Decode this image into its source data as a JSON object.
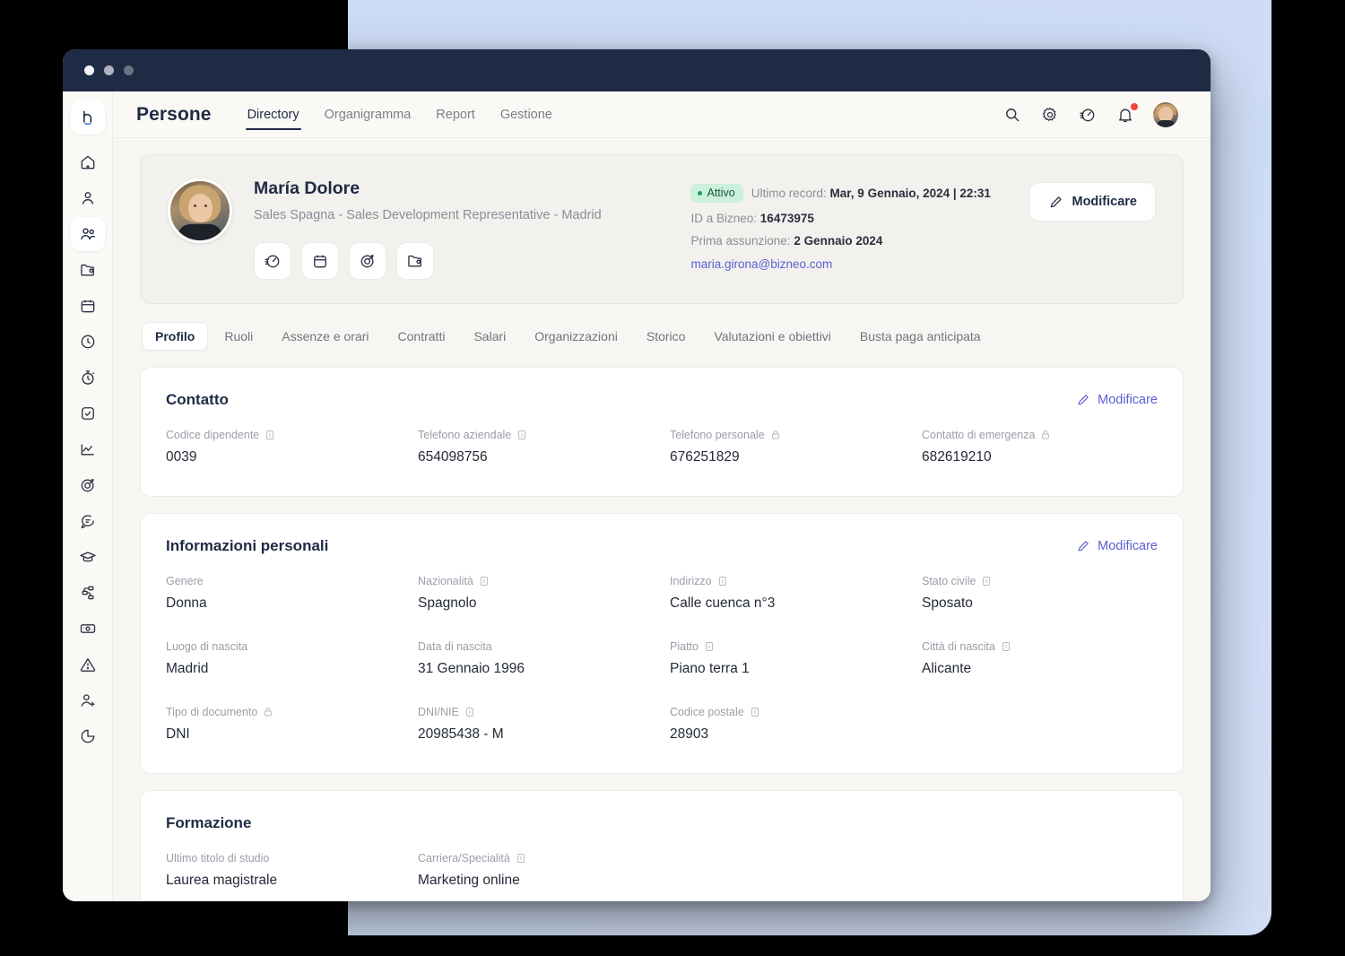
{
  "window": {
    "dots": [
      "close",
      "minimize",
      "maximize"
    ]
  },
  "header": {
    "app_title": "Persone",
    "nav": [
      {
        "label": "Directory",
        "active": true
      },
      {
        "label": "Organigramma",
        "active": false
      },
      {
        "label": "Report",
        "active": false
      },
      {
        "label": "Gestione",
        "active": false
      }
    ],
    "icons": [
      "search-icon",
      "gear-icon",
      "speedometer-icon",
      "bell-icon",
      "avatar"
    ]
  },
  "sidebar": {
    "logo": "bizneo-logo",
    "items": [
      {
        "icon": "home-icon",
        "active": false
      },
      {
        "icon": "user-icon",
        "active": false
      },
      {
        "icon": "people-icon",
        "active": true
      },
      {
        "icon": "folder-icon",
        "active": false
      },
      {
        "icon": "calendar-icon",
        "active": false
      },
      {
        "icon": "clock-icon",
        "active": false
      },
      {
        "icon": "stopwatch-icon",
        "active": false
      },
      {
        "icon": "check-square-icon",
        "active": false
      },
      {
        "icon": "chart-line-icon",
        "active": false
      },
      {
        "icon": "target-icon",
        "active": false
      },
      {
        "icon": "chat-icon",
        "active": false
      },
      {
        "icon": "graduation-cap-icon",
        "active": false
      },
      {
        "icon": "workflow-icon",
        "active": false
      },
      {
        "icon": "money-icon",
        "active": false
      },
      {
        "icon": "warning-icon",
        "active": false
      },
      {
        "icon": "user-plus-icon",
        "active": false
      },
      {
        "icon": "pie-chart-icon",
        "active": false
      }
    ]
  },
  "profile": {
    "name": "María Dolore",
    "role": "Sales Spagna - Sales Development Representative - Madrid",
    "quick_actions": [
      "speedometer-icon",
      "calendar-icon",
      "target-icon",
      "folder-icon"
    ],
    "status": "Attivo",
    "last_record_label": "Ultimo record:",
    "last_record_value": "Mar, 9 Gennaio, 2024 | 22:31",
    "bizneo_id_label": "ID a Bizneo:",
    "bizneo_id_value": "16473975",
    "first_hire_label": "Prima assunzione:",
    "first_hire_value": "2 Gennaio 2024",
    "email": "maria.girona@bizneo.com",
    "edit_label": "Modificare"
  },
  "section_tabs": [
    {
      "label": "Profilo",
      "active": true
    },
    {
      "label": "Ruoli",
      "active": false
    },
    {
      "label": "Assenze e orari",
      "active": false
    },
    {
      "label": "Contratti",
      "active": false
    },
    {
      "label": "Salari",
      "active": false
    },
    {
      "label": "Organizzazioni",
      "active": false
    },
    {
      "label": "Storico",
      "active": false
    },
    {
      "label": "Valutazioni e obiettivi",
      "active": false
    },
    {
      "label": "Busta paga anticipata",
      "active": false
    }
  ],
  "panels": [
    {
      "title": "Contatto",
      "edit_label": "Modificare",
      "fields": [
        {
          "label": "Codice dipendente",
          "icon": "id-card-icon",
          "value": "0039"
        },
        {
          "label": "Telefono aziendale",
          "icon": "id-card-icon",
          "value": "654098756"
        },
        {
          "label": "Telefono personale",
          "icon": "lock-icon",
          "value": "676251829"
        },
        {
          "label": "Contatto di emergenza",
          "icon": "lock-icon",
          "value": "682619210"
        }
      ]
    },
    {
      "title": "Informazioni personali",
      "edit_label": "Modificare",
      "fields": [
        {
          "label": "Genere",
          "icon": "",
          "value": "Donna"
        },
        {
          "label": "Nazionalità",
          "icon": "id-card-icon",
          "value": "Spagnolo"
        },
        {
          "label": "Indirizzo",
          "icon": "id-card-icon",
          "value": "Calle cuenca n°3"
        },
        {
          "label": "Stato civile",
          "icon": "id-card-icon",
          "value": "Sposato"
        },
        {
          "label": "Luogo di nascita",
          "icon": "",
          "value": "Madrid"
        },
        {
          "label": "Data di nascita",
          "icon": "",
          "value": "31 Gennaio 1996"
        },
        {
          "label": "Piatto",
          "icon": "id-card-icon",
          "value": "Piano terra 1"
        },
        {
          "label": "Città di nascita",
          "icon": "id-card-icon",
          "value": "Alicante"
        },
        {
          "label": "Tipo di documento",
          "icon": "lock-icon",
          "value": "DNI"
        },
        {
          "label": "DNI/NIE",
          "icon": "id-card-icon",
          "value": "20985438 - M"
        },
        {
          "label": "Codice postale",
          "icon": "id-card-icon",
          "value": "28903"
        },
        {
          "label": "",
          "icon": "",
          "value": ""
        }
      ]
    },
    {
      "title": "Formazione",
      "edit_label": "",
      "fields": [
        {
          "label": "Ultimo titolo di studio",
          "icon": "",
          "value": "Laurea magistrale"
        },
        {
          "label": "Carriera/Specialità",
          "icon": "id-card-icon",
          "value": "Marketing online"
        },
        {
          "label": "",
          "icon": "",
          "value": ""
        },
        {
          "label": "",
          "icon": "",
          "value": ""
        }
      ]
    }
  ],
  "colors": {
    "accent_link": "#5b5fd1",
    "status_bg": "#cdf0dd",
    "status_text": "#19573a",
    "titlebar": "#1f2a44",
    "backdrop_blue": "#cddcf5",
    "notification": "#f0463c"
  }
}
